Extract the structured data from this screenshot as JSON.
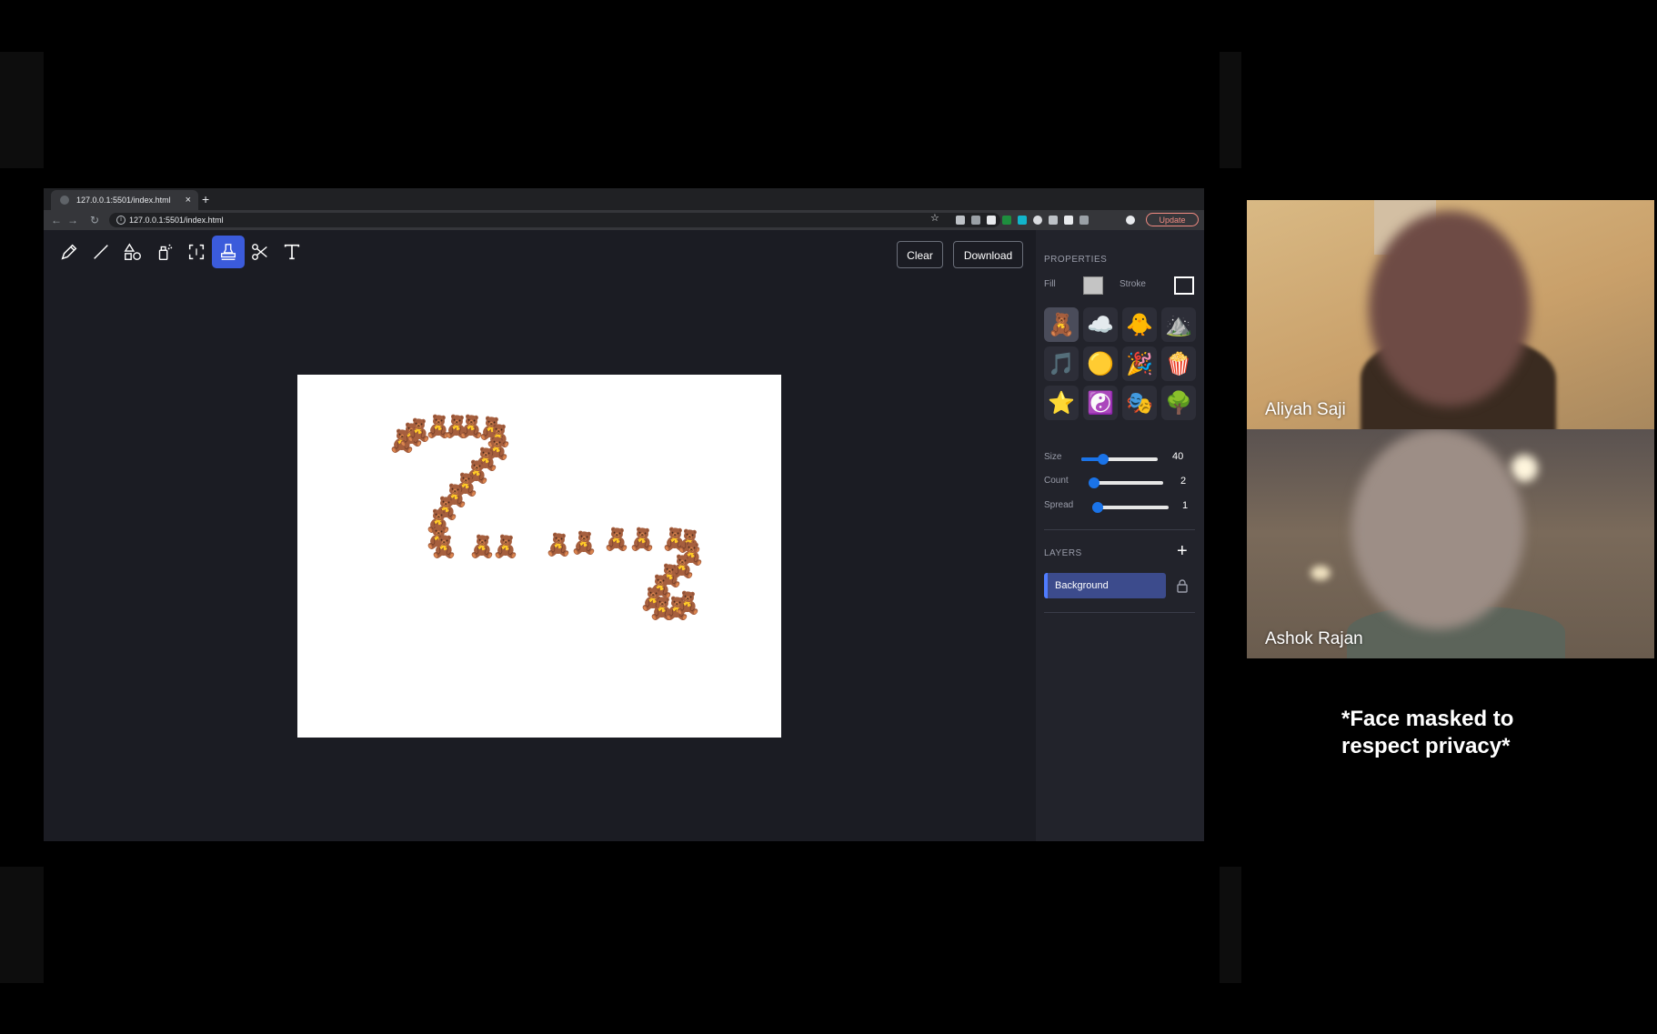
{
  "browser": {
    "tab_title": "127.0.0.1:5501/index.html",
    "tab_close": "×",
    "new_tab": "+",
    "url": "127.0.0.1:5501/index.html",
    "update_label": "Update"
  },
  "toolbar": {
    "tools": [
      "pencil",
      "line",
      "shapes",
      "spray",
      "select",
      "stamp",
      "cut",
      "text"
    ],
    "active_tool": "stamp",
    "clear_label": "Clear",
    "download_label": "Download"
  },
  "properties": {
    "heading": "PROPERTIES",
    "fill_label": "Fill",
    "fill_color": "#c4c4c4",
    "stroke_label": "Stroke",
    "stroke_color": "#ffffff",
    "stamps": [
      "🧸",
      "☁️",
      "🐥",
      "⛰️",
      "🎵",
      "🟡",
      "🎉",
      "🍿",
      "⭐",
      "☯️",
      "🎭",
      "🌳"
    ],
    "selected_stamp": "🧸",
    "size_label": "Size",
    "size_value": "40",
    "count_label": "Count",
    "count_value": "2",
    "spread_label": "Spread",
    "spread_value": "1"
  },
  "layers": {
    "heading": "LAYERS",
    "add_icon": "+",
    "items": [
      {
        "name": "Background",
        "locked": true
      }
    ]
  },
  "participants": [
    {
      "name": "Aliyah Saji"
    },
    {
      "name": "Ashok Rajan"
    }
  ],
  "note_line1": "*Face masked to",
  "note_line2": "respect privacy*",
  "colors": {
    "accent": "#3b5bdb",
    "app_bg": "#1b1c23",
    "panel_bg": "#22232b"
  }
}
